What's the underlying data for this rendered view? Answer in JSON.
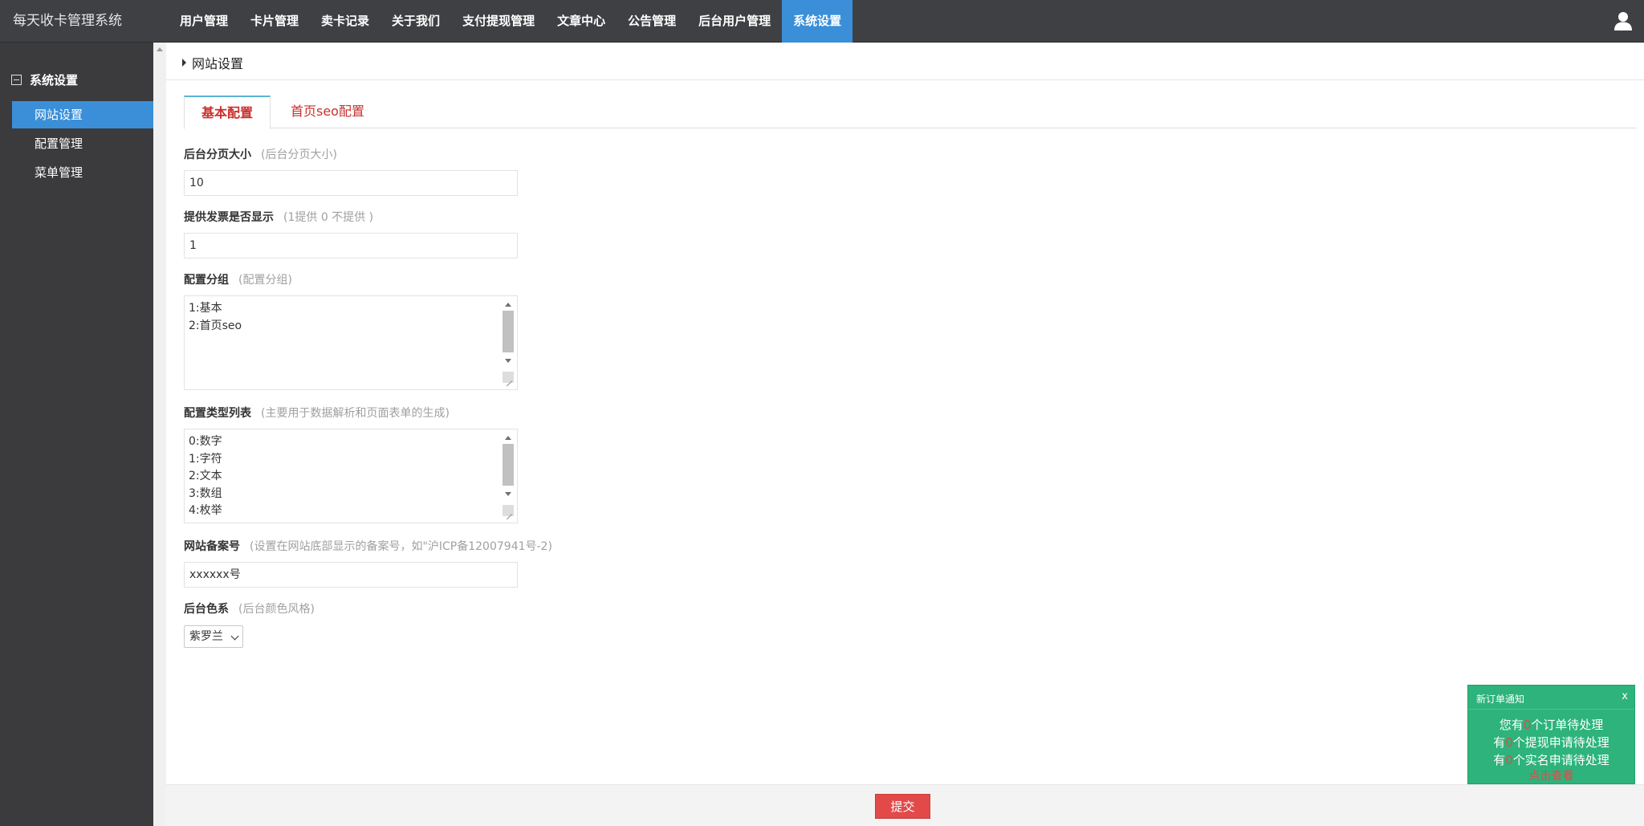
{
  "app": {
    "title": "每天收卡管理系统"
  },
  "nav": {
    "items": [
      {
        "label": "用户管理"
      },
      {
        "label": "卡片管理"
      },
      {
        "label": "卖卡记录"
      },
      {
        "label": "关于我们"
      },
      {
        "label": "支付提现管理"
      },
      {
        "label": "文章中心"
      },
      {
        "label": "公告管理"
      },
      {
        "label": "后台用户管理"
      },
      {
        "label": "系统设置"
      }
    ],
    "active": "系统设置"
  },
  "sidebar": {
    "group_label": "系统设置",
    "items": [
      {
        "label": "网站设置"
      },
      {
        "label": "配置管理"
      },
      {
        "label": "菜单管理"
      }
    ],
    "active": "网站设置"
  },
  "page": {
    "title": "网站设置",
    "tabs": [
      {
        "label": "基本配置"
      },
      {
        "label": "首页seo配置"
      }
    ],
    "active_tab": "基本配置"
  },
  "fields": {
    "page_size": {
      "label": "后台分页大小",
      "hint": "(后台分页大小)",
      "value": "10"
    },
    "invoice": {
      "label": "提供发票是否显示",
      "hint": "(1提供 0 不提供 )",
      "value": "1"
    },
    "config_group": {
      "label": "配置分组",
      "hint": "(配置分组)",
      "lines": [
        "1:基本",
        "2:首页seo"
      ]
    },
    "config_types": {
      "label": "配置类型列表",
      "hint": "(主要用于数据解析和页面表单的生成)",
      "lines": [
        "0:数字",
        "1:字符",
        "2:文本",
        "3:数组",
        "4:枚举"
      ]
    },
    "icp": {
      "label": "网站备案号",
      "hint": "(设置在网站底部显示的备案号，如\"沪ICP备12007941号-2)",
      "value": "xxxxxx号"
    },
    "theme": {
      "label": "后台色系",
      "hint": "(后台颜色风格)",
      "value": "紫罗兰"
    }
  },
  "footer": {
    "submit_label": "提交"
  },
  "notification": {
    "title": "新订单通知",
    "close": "x",
    "line1_pre": "您有",
    "line1_num": "0",
    "line1_post": "个订单待处理",
    "line2_pre": "有",
    "line2_num": "0",
    "line2_post": "个提现申请待处理",
    "line3_pre": "有",
    "line3_num": "0",
    "line3_post": "个实名申请待处理",
    "link": "点击查看"
  },
  "colors": {
    "nav_bg": "#3f4044",
    "accent_blue": "#3a8fd8",
    "submit_red": "#e24a4a",
    "notify_green": "#2db37b"
  },
  "icons": {
    "user": "user-icon",
    "collapse": "minus-box-icon",
    "caret": "caret-right-icon"
  }
}
